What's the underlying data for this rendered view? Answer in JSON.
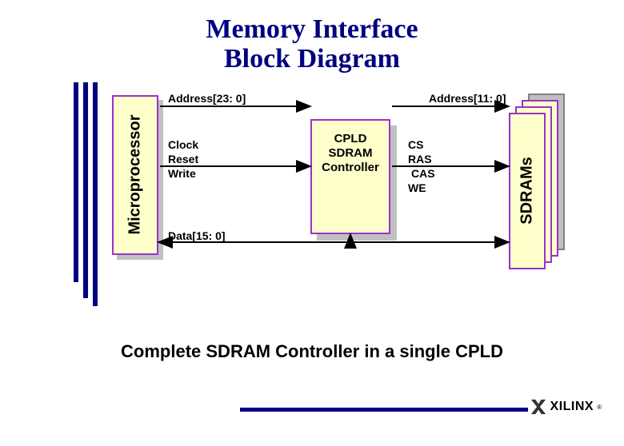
{
  "title_line1": "Memory Interface",
  "title_line2": "Block Diagram",
  "blocks": {
    "microprocessor": "Microprocessor",
    "controller_line1": "CPLD",
    "controller_line2": "SDRAM",
    "controller_line3": "Controller",
    "sdrams": "SDRAMs"
  },
  "signals": {
    "addr_in": "Address[23: 0]",
    "addr_out": "Address[11: 0]",
    "clock": "Clock",
    "reset": "Reset",
    "write": "Write",
    "data": "Data[15: 0]",
    "cs": "CS",
    "ras": "RAS",
    "cas": "CAS",
    "we": "WE"
  },
  "caption": "Complete SDRAM Controller in a single CPLD",
  "logo": "XILINX",
  "colors": {
    "title": "#000080",
    "block_fill": "#ffffcc",
    "block_border": "#9933cc",
    "shadow": "#c0c0c0"
  }
}
